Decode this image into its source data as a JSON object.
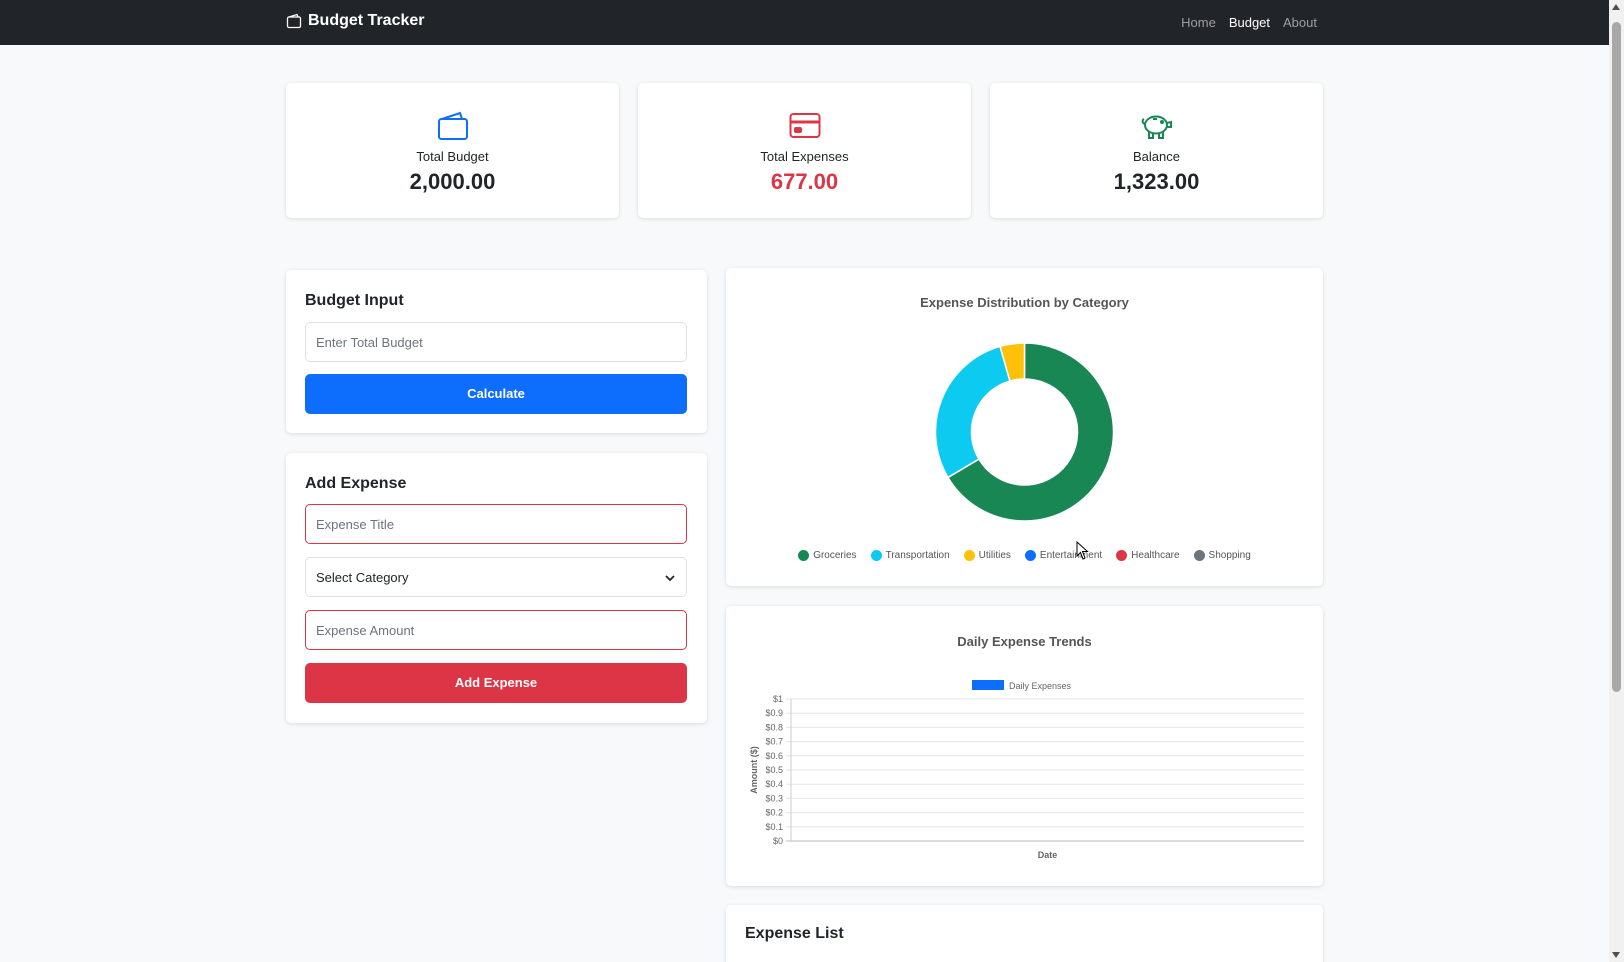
{
  "navbar": {
    "brand": "Budget Tracker",
    "links": [
      {
        "label": "Home",
        "active": false
      },
      {
        "label": "Budget",
        "active": true
      },
      {
        "label": "About",
        "active": false
      }
    ]
  },
  "summary": {
    "budget": {
      "label": "Total Budget",
      "value": "2,000.00",
      "icon": "wallet-icon"
    },
    "expenses": {
      "label": "Total Expenses",
      "value": "677.00",
      "icon": "credit-card-icon"
    },
    "balance": {
      "label": "Balance",
      "value": "1,323.00",
      "icon": "piggy-bank-icon"
    }
  },
  "budget_input": {
    "title": "Budget Input",
    "placeholder": "Enter Total Budget",
    "button": "Calculate"
  },
  "add_expense": {
    "title": "Add Expense",
    "title_placeholder": "Expense Title",
    "category_value": "Select Category",
    "amount_placeholder": "Expense Amount",
    "button": "Add Expense"
  },
  "colors": {
    "groceries": "#198754",
    "transportation": "#0dcaf0",
    "utilities": "#ffc107",
    "entertainment": "#0d6efd",
    "healthcare": "#dc3545",
    "shopping": "#6c757d"
  },
  "expense_list": {
    "title": "Expense List"
  },
  "chart_data": [
    {
      "type": "pie",
      "title": "Expense Distribution by Category",
      "categories": [
        "Groceries",
        "Transportation",
        "Utilities",
        "Entertainment",
        "Healthcare",
        "Shopping"
      ],
      "values": [
        450,
        197,
        30,
        0,
        0,
        0
      ],
      "legend": "bottom"
    },
    {
      "type": "bar",
      "title": "Daily Expense Trends",
      "xlabel": "Date",
      "ylabel": "Amount ($)",
      "yticks": [
        "$0",
        "$0.1",
        "$0.2",
        "$0.3",
        "$0.4",
        "$0.5",
        "$0.6",
        "$0.7",
        "$0.8",
        "$0.9",
        "$1"
      ],
      "ylim": [
        0,
        1
      ],
      "categories": [],
      "series": [
        {
          "name": "Daily Expenses",
          "values": []
        }
      ],
      "legend": "top"
    }
  ]
}
